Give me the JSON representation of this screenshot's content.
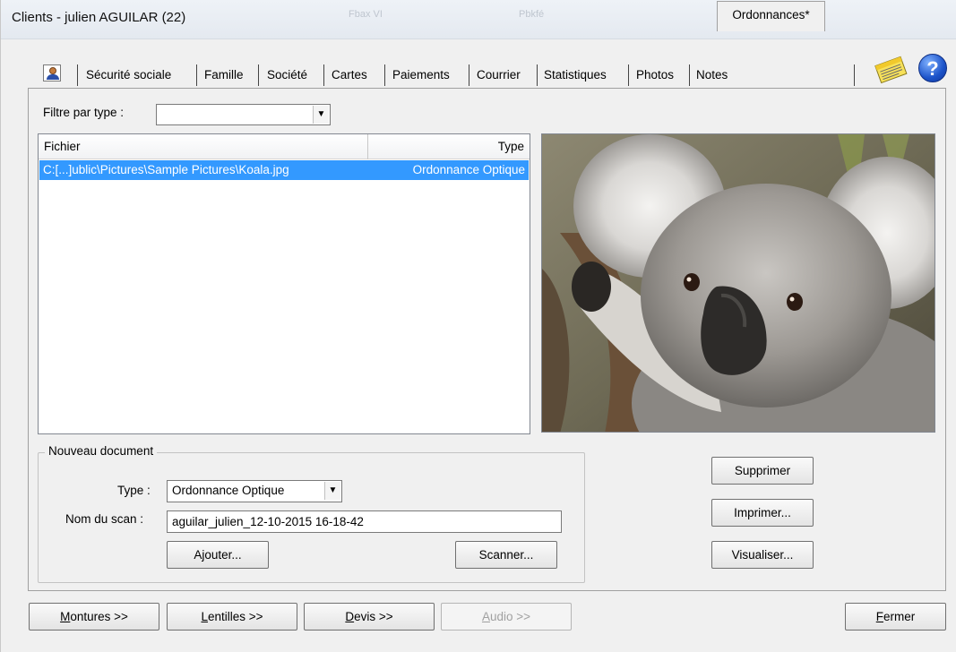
{
  "window": {
    "title": "Clients - julien AGUILAR (22)",
    "ghost_texts": [
      "Fbax VI",
      "Pbkfé"
    ]
  },
  "tabs": [
    {
      "label": "Sécurité sociale"
    },
    {
      "label": "Famille"
    },
    {
      "label": "Société"
    },
    {
      "label": "Cartes"
    },
    {
      "label": "Paiements"
    },
    {
      "label": "Courrier"
    },
    {
      "label": "Statistiques"
    },
    {
      "label": "Photos"
    },
    {
      "label": "Notes"
    },
    {
      "label": "Ordonnances*",
      "active": true
    }
  ],
  "icons": {
    "contact": "contact-card-icon",
    "notes": "sticky-notes-icon",
    "help": "help-icon",
    "help_glyph": "?"
  },
  "filter": {
    "label": "Filtre par type :",
    "value": ""
  },
  "list": {
    "columns": [
      "Fichier",
      "Type"
    ],
    "rows": [
      {
        "file": "C:[...]ublic\\Pictures\\Sample Pictures\\Koala.jpg",
        "type": "Ordonnance Optique",
        "selected": true
      }
    ]
  },
  "new_document": {
    "group_title": "Nouveau document",
    "type_label": "Type :",
    "type_value": "Ordonnance Optique",
    "scan_label": "Nom du scan :",
    "scan_value": "aguilar_julien_12-10-2015 16-18-42",
    "add_button": "Ajouter...",
    "scan_button": "Scanner..."
  },
  "side_buttons": {
    "delete": "Supprimer",
    "print": "Imprimer...",
    "view": "Visualiser..."
  },
  "bottom_buttons": {
    "frames_key": "M",
    "frames_rest": "ontures  >>",
    "lenses_key": "L",
    "lenses_rest": "entilles  >>",
    "quote_key": "D",
    "quote_rest": "evis  >>",
    "audio_key": "A",
    "audio_rest": "udio  >>",
    "close_key": "F",
    "close_rest": "ermer"
  },
  "colors": {
    "selection": "#3399ff",
    "window_bg": "#f0f0f0"
  }
}
